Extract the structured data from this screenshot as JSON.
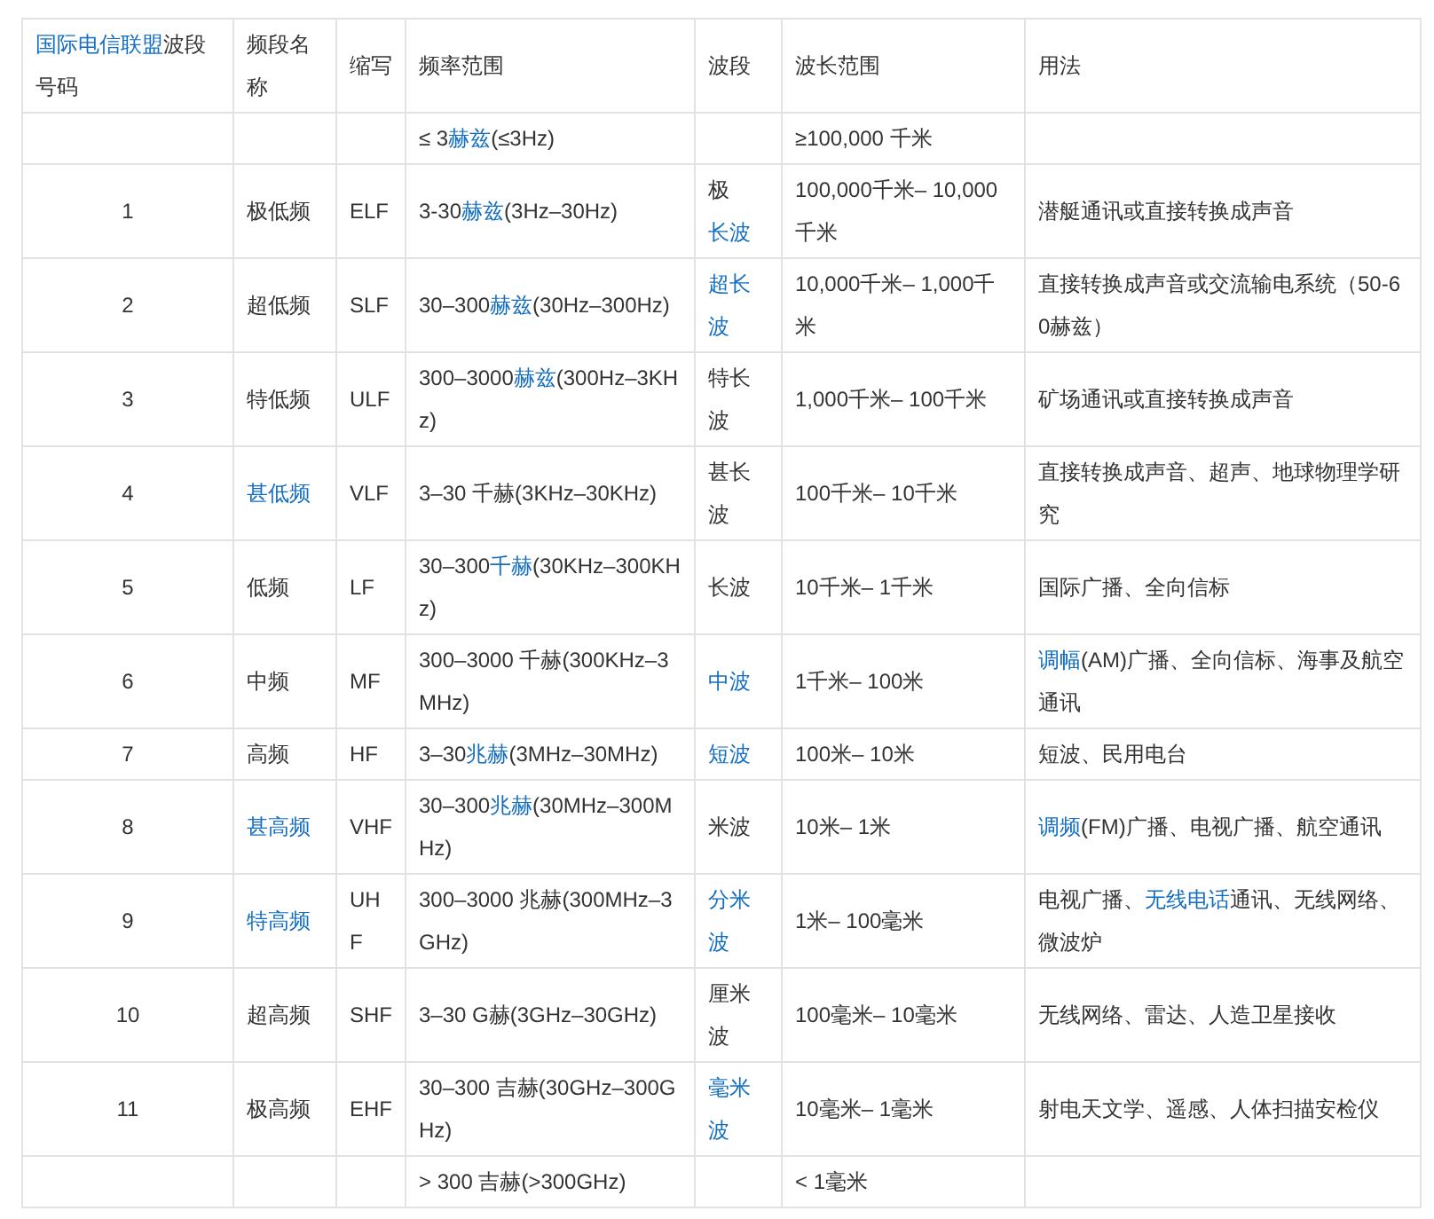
{
  "table": {
    "columns": [
      [
        {
          "link": "国际电信联盟"
        },
        "波段号码"
      ],
      "频段名称",
      "缩写",
      "频率范围",
      "波段",
      "波长范围",
      "用法"
    ],
    "rows": [
      [
        null,
        null,
        null,
        [
          "≤ 3",
          {
            "link": "赫兹"
          },
          "(≤3Hz)"
        ],
        null,
        "≥100,000 千米",
        null
      ],
      [
        "1",
        "极低频",
        "ELF",
        [
          "3-30",
          {
            "link": "赫兹"
          },
          "(3Hz–30Hz)"
        ],
        [
          "极",
          {
            "link": "长波"
          }
        ],
        "100,000千米– 10,000千米",
        "潜艇通讯或直接转换成声音"
      ],
      [
        "2",
        "超低频",
        "SLF",
        [
          "30–300",
          {
            "link": "赫兹"
          },
          "(30Hz–300Hz)"
        ],
        [
          {
            "link": "超长波"
          }
        ],
        "10,000千米– 1,000千米",
        "直接转换成声音或交流输电系统（50-60赫兹）"
      ],
      [
        "3",
        "特低频",
        "ULF",
        [
          "300–3000",
          {
            "link": "赫兹"
          },
          "(300Hz–3KHz)"
        ],
        "特长波",
        "1,000千米– 100千米",
        "矿场通讯或直接转换成声音"
      ],
      [
        "4",
        [
          {
            "link": "甚低频"
          }
        ],
        "VLF",
        "3–30 千赫(3KHz–30KHz)",
        "甚长波",
        "100千米– 10千米",
        "直接转换成声音、超声、地球物理学研究"
      ],
      [
        "5",
        "低频",
        "LF",
        [
          "30–300",
          {
            "link": "千赫"
          },
          "(30KHz–300KHz)"
        ],
        "长波",
        "10千米– 1千米",
        "国际广播、全向信标"
      ],
      [
        "6",
        "中频",
        "MF",
        "300–3000 千赫(300KHz–3MHz)",
        [
          {
            "link": "中波"
          }
        ],
        "1千米– 100米",
        [
          {
            "link": "调幅"
          },
          "(AM)广播、全向信标、海事及航空通讯"
        ]
      ],
      [
        "7",
        "高频",
        "HF",
        [
          "3–30",
          {
            "link": "兆赫"
          },
          "(3MHz–30MHz)"
        ],
        [
          {
            "link": "短波"
          }
        ],
        "100米– 10米",
        "短波、民用电台"
      ],
      [
        "8",
        [
          {
            "link": "甚高频"
          }
        ],
        "VHF",
        [
          "30–300",
          {
            "link": "兆赫"
          },
          "(30MHz–300MHz)"
        ],
        "米波",
        "10米– 1米",
        [
          {
            "link": "调频"
          },
          "(FM)广播、电视广播、航空通讯"
        ]
      ],
      [
        "9",
        [
          {
            "link": "特高频"
          }
        ],
        "UHF",
        "300–3000 兆赫(300MHz–3GHz)",
        [
          {
            "link": "分米波"
          }
        ],
        "1米– 100毫米",
        [
          "电视广播、",
          {
            "link": "无线电话"
          },
          "通讯、无线网络、微波炉"
        ]
      ],
      [
        "10",
        "超高频",
        "SHF",
        "3–30 G赫(3GHz–30GHz)",
        "厘米波",
        "100毫米– 10毫米",
        "无线网络、雷达、人造卫星接收"
      ],
      [
        "11",
        "极高频",
        "EHF",
        "30–300 吉赫(30GHz–300GHz)",
        [
          {
            "link": "毫米波"
          }
        ],
        "10毫米– 1毫米",
        "射电天文学、遥感、人体扫描安检仪"
      ],
      [
        null,
        null,
        null,
        "> 300 吉赫(>300GHz)",
        null,
        "< 1毫米",
        null
      ]
    ]
  }
}
